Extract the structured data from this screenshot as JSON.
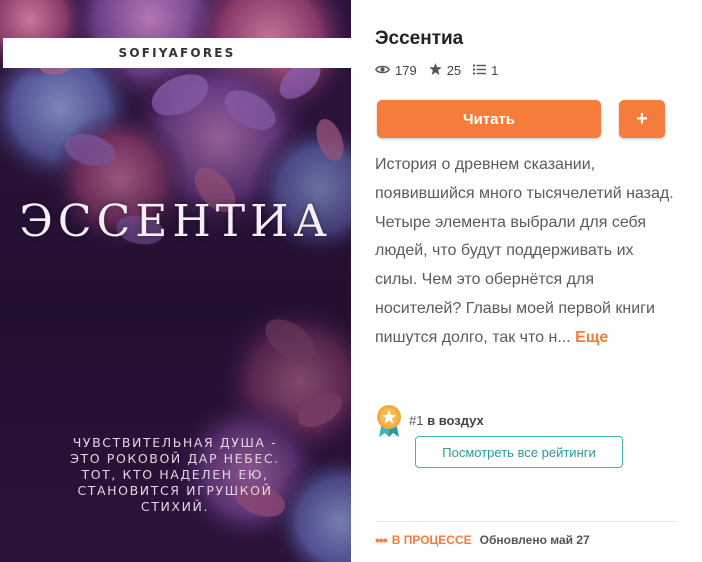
{
  "cover": {
    "author": "SOFIYAFORES",
    "title": "ЭССЕНТИА",
    "tagline": "ЧУВСТВИТЕЛЬНАЯ ДУША -\nЭТО РОКОВОЙ ДАР НЕБЕС.\nТОТ, КТО НАДЕЛЕН ЕЮ,\nСТАНОВИТСЯ ИГРУШКОЙ\nСТИХИЙ."
  },
  "story": {
    "title": "Эссентиа",
    "stats": {
      "reads": "179",
      "votes": "25",
      "parts": "1"
    },
    "icons": [
      "eye-icon",
      "star-icon",
      "list-icon"
    ],
    "description": "История о древнем сказании, появившийся много тысячелетий назад. Четыре элемента выбрали для себя людей, что будут поддерживать их силы. Чем это обернётся для носителей? Главы моей первой книги пишутся долго, так что н...",
    "more_label": "Еще"
  },
  "actions": {
    "read_label": "Читать",
    "add_label": "+"
  },
  "ranking": {
    "rank": "#1",
    "tag": "в воздух",
    "button_label": "Посмотреть все рейтинги"
  },
  "status": {
    "state": "В ПРОЦЕССЕ",
    "updated": "Обновлено май 27"
  },
  "colors": {
    "accent": "#f57c3a",
    "teal": "#3fb3b3",
    "cover_bg": "#2a1238"
  }
}
